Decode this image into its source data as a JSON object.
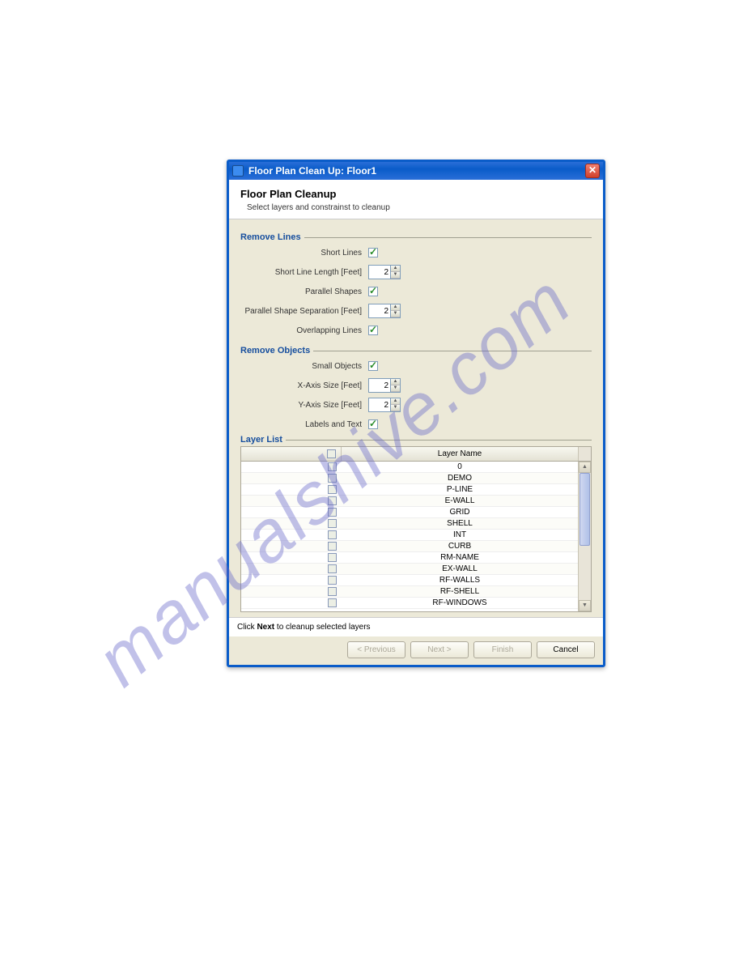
{
  "watermark": "manualshive.com",
  "titlebar": {
    "title": "Floor Plan Clean Up: Floor1"
  },
  "header": {
    "title": "Floor Plan Cleanup",
    "subtitle": "Select layers and constrainst to cleanup"
  },
  "groups": {
    "removeLines": "Remove Lines",
    "removeObjects": "Remove Objects",
    "layerList": "Layer List"
  },
  "fields": {
    "shortLines": {
      "label": "Short Lines",
      "checked": true
    },
    "shortLineLength": {
      "label": "Short Line Length [Feet]",
      "value": "2"
    },
    "parallelShapes": {
      "label": "Parallel Shapes",
      "checked": true
    },
    "parallelSeparation": {
      "label": "Parallel Shape Separation [Feet]",
      "value": "2"
    },
    "overlappingLines": {
      "label": "Overlapping Lines",
      "checked": true
    },
    "smallObjects": {
      "label": "Small Objects",
      "checked": true
    },
    "xAxisSize": {
      "label": "X-Axis Size [Feet]",
      "value": "2"
    },
    "yAxisSize": {
      "label": "Y-Axis Size [Feet]",
      "value": "2"
    },
    "labelsAndText": {
      "label": "Labels and Text",
      "checked": true
    }
  },
  "layerTable": {
    "columnHeader": "Layer Name",
    "layers": [
      "0",
      "DEMO",
      "P-LINE",
      "E-WALL",
      "GRID",
      "SHELL",
      "INT",
      "CURB",
      "RM-NAME",
      "EX-WALL",
      "RF-WALLS",
      "RF-SHELL",
      "RF-WINDOWS"
    ]
  },
  "footer": {
    "noteBefore": "Click ",
    "noteBold": "Next",
    "noteAfter": " to cleanup selected layers"
  },
  "buttons": {
    "previous": "< Previous",
    "next": "Next >",
    "finish": "Finish",
    "cancel": "Cancel"
  }
}
